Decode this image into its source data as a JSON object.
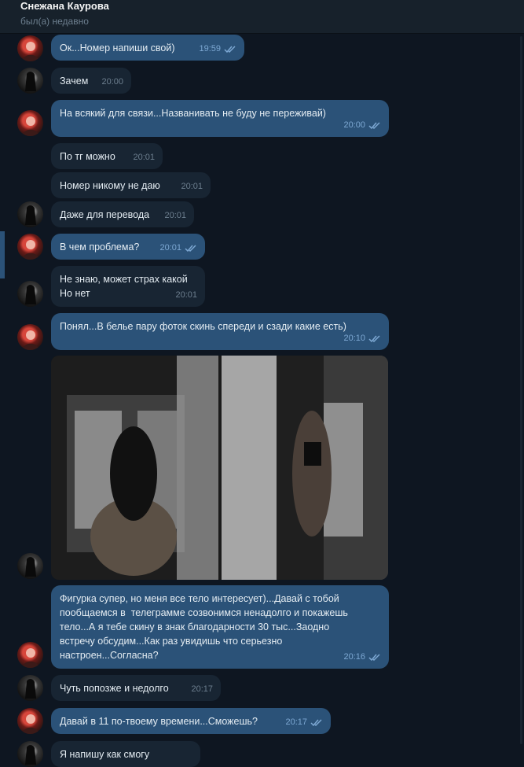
{
  "header": {
    "name": "Снежана Каурова",
    "status": "был(а) недавно"
  },
  "messages": [
    {
      "text": "Ок...Номер напиши свой)",
      "time": "19:59"
    },
    {
      "text": "Зачем",
      "time": "20:00"
    },
    {
      "text": "На всякий для связи...Названивать не буду не переживай)",
      "time": "20:00"
    },
    {
      "text": "По тг можно",
      "time": "20:01"
    },
    {
      "text": "Номер никому не даю",
      "time": "20:01"
    },
    {
      "text": "Даже для перевода",
      "time": "20:01"
    },
    {
      "text": "В чем проблема?",
      "time": "20:01"
    },
    {
      "text": "Не знаю, может страх какой\nНо нет",
      "time": "20:01"
    },
    {
      "text": "Понял...В белье пару фоток скинь спереди и сзади какие есть)",
      "time": "20:10"
    },
    {
      "text": "Фигурка супер, но меня все тело интересует)...Давай с тобой\nпообщаемся в  телеграмме созвонимся ненадолго и покажешь\nтело...А я тебе скину в знак благодарности 30 тыс...Заодно\nвстречу обсудим...Как раз увидишь что серьезно\nнастроен...Согласна?",
      "time": "20:16"
    },
    {
      "text": "Чуть попозже и недолго",
      "time": "20:17"
    },
    {
      "text": "Давай в 11 по-твоему времени...Сможешь?",
      "time": "20:17"
    },
    {
      "text": "Я напишу как смогу",
      "time": ""
    }
  ]
}
